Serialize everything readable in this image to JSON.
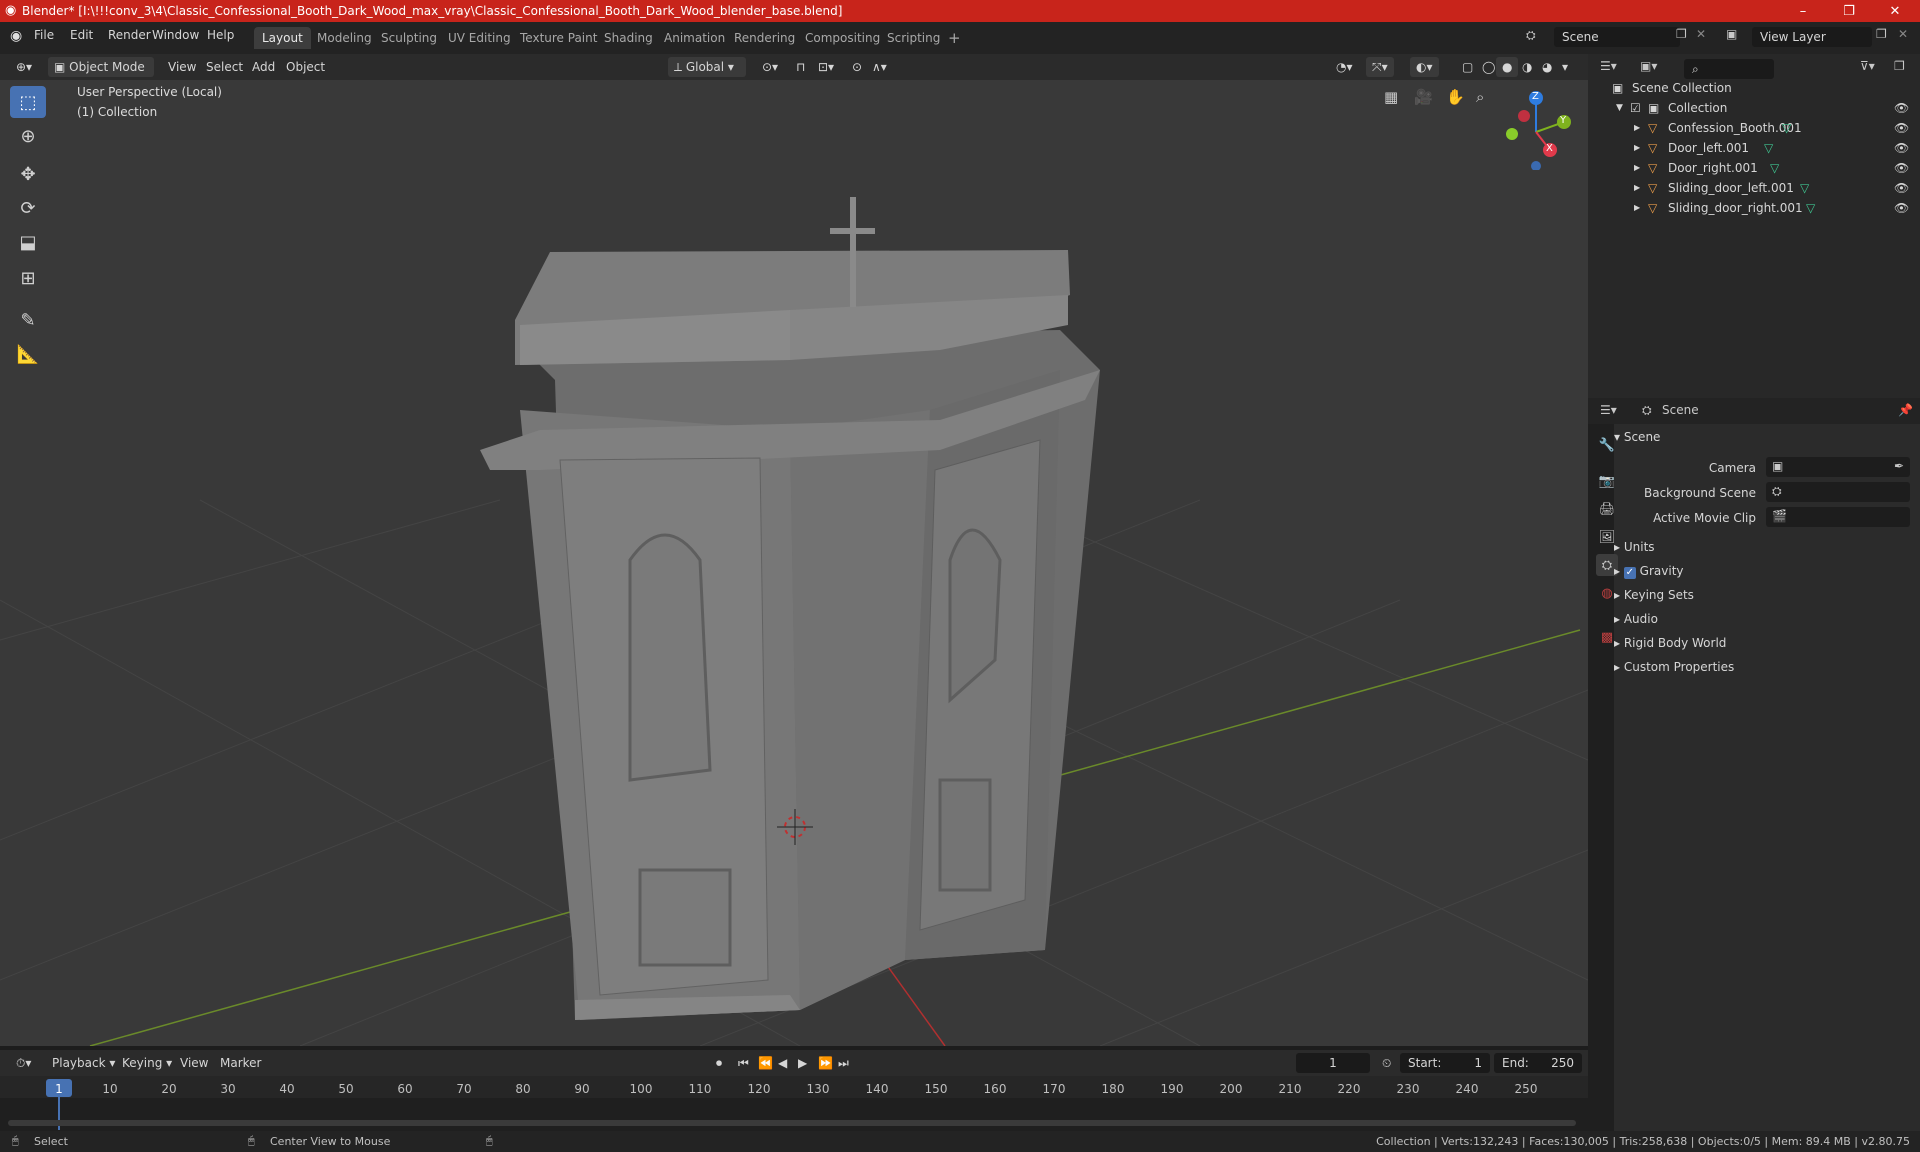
{
  "window": {
    "title": "Blender* [I:\\!!!conv_3\\4\\Classic_Confessional_Booth_Dark_Wood_max_vray\\Classic_Confessional_Booth_Dark_Wood_blender_base.blend]",
    "minimize": "–",
    "maximize": "❐",
    "close": "✕"
  },
  "menu": {
    "items": [
      "File",
      "Edit",
      "Render",
      "Window",
      "Help"
    ]
  },
  "workspaces": {
    "tabs": [
      "Layout",
      "Modeling",
      "Sculpting",
      "UV Editing",
      "Texture Paint",
      "Shading",
      "Animation",
      "Rendering",
      "Compositing",
      "Scripting"
    ],
    "active": "Layout",
    "add": "+"
  },
  "scene_selector": {
    "value": "Scene"
  },
  "view_layer_selector": {
    "value": "View Layer"
  },
  "viewport_header": {
    "mode": "Object Mode",
    "menus": [
      "View",
      "Select",
      "Add",
      "Object"
    ],
    "orientation": "Global"
  },
  "viewport": {
    "perspective_label": "User Perspective (Local)",
    "collection_label": "(1) Collection",
    "gizmo_axes": {
      "z": "Z",
      "y": "Y",
      "x": "X"
    }
  },
  "outliner": {
    "root": "Scene Collection",
    "collection": "Collection",
    "objects": [
      "Confession_Booth.001",
      "Door_left.001",
      "Door_right.001",
      "Sliding_door_left.001",
      "Sliding_door_right.001"
    ]
  },
  "properties": {
    "header_title": "Scene",
    "panel_title": "Scene",
    "camera_label": "Camera",
    "background_scene_label": "Background Scene",
    "active_movie_clip_label": "Active Movie Clip",
    "subpanels": [
      "Units",
      "Gravity",
      "Keying Sets",
      "Audio",
      "Rigid Body World",
      "Custom Properties"
    ],
    "gravity_checked": true
  },
  "timeline": {
    "menus": [
      "Playback",
      "Keying",
      "View",
      "Marker"
    ],
    "current_frame": "1",
    "start_label": "Start:",
    "start_value": "1",
    "end_label": "End:",
    "end_value": "250",
    "ticks": [
      "1",
      "10",
      "20",
      "30",
      "40",
      "50",
      "60",
      "70",
      "80",
      "90",
      "100",
      "110",
      "120",
      "130",
      "140",
      "150",
      "160",
      "170",
      "180",
      "190",
      "200",
      "210",
      "220",
      "230",
      "240",
      "250"
    ]
  },
  "statusbar": {
    "select": "Select",
    "center_view": "Center View to Mouse",
    "stats": "Collection | Verts:132,243 | Faces:130,005 | Tris:258,638 | Objects:0/5 | Mem: 89.4 MB | v2.80.75"
  },
  "colors": {
    "titlebar": "#c8241b",
    "accent": "#4772b3",
    "viewport_bg": "#393939",
    "mesh_icon": "#e89b4a",
    "data_icon": "#3fc38f"
  }
}
